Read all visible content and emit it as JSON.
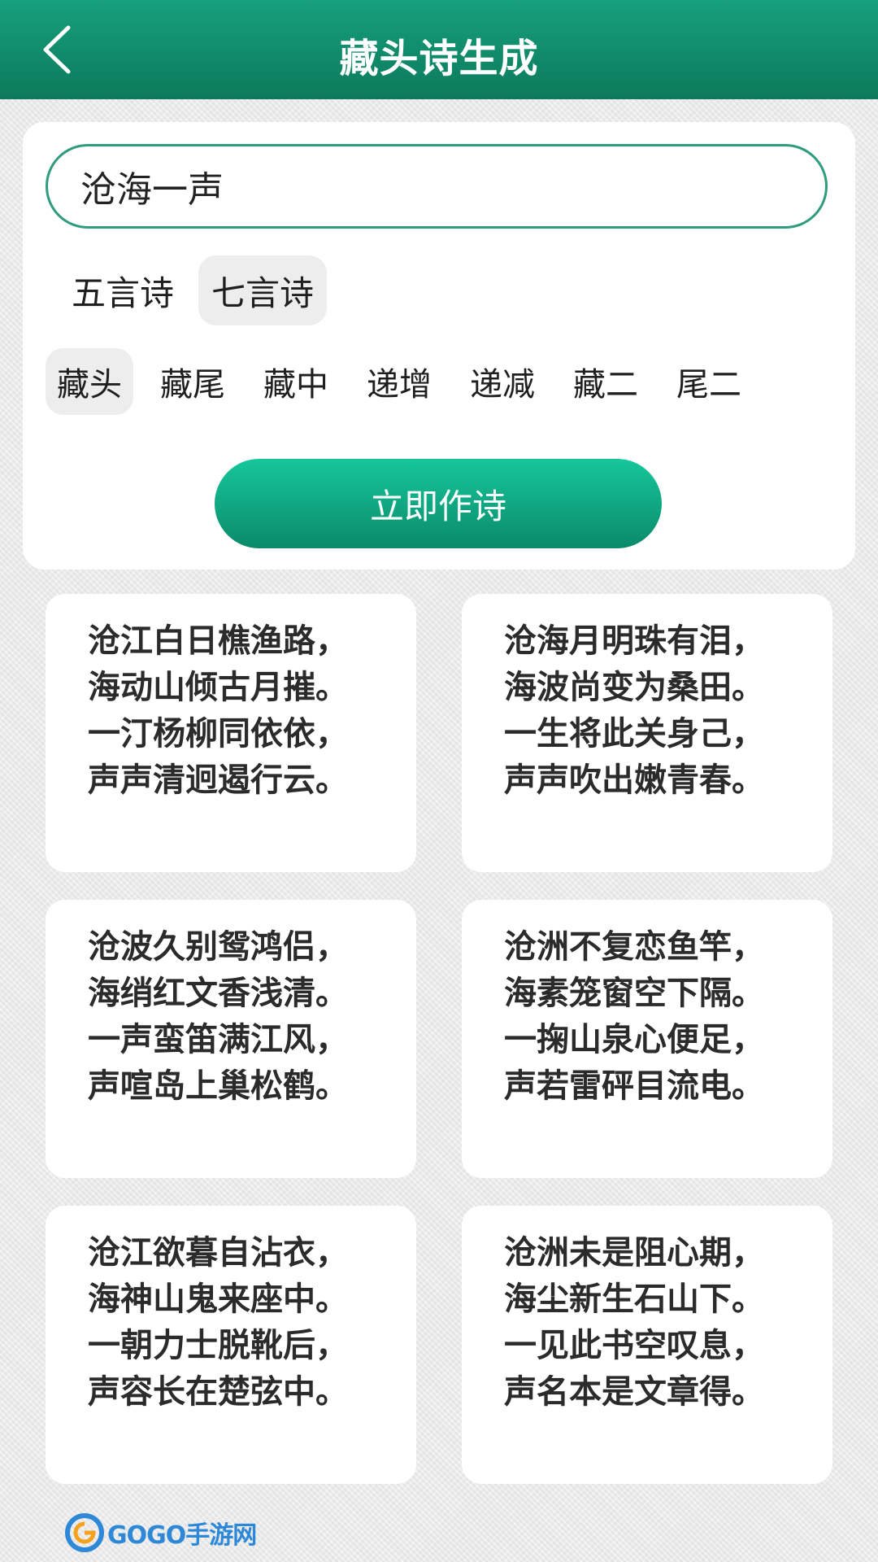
{
  "header": {
    "title": "藏头诗生成"
  },
  "search": {
    "value": "沧海一声"
  },
  "poem_types": [
    {
      "label": "五言诗",
      "selected": false
    },
    {
      "label": "七言诗",
      "selected": true
    }
  ],
  "modes": [
    {
      "label": "藏头",
      "selected": true
    },
    {
      "label": "藏尾",
      "selected": false
    },
    {
      "label": "藏中",
      "selected": false
    },
    {
      "label": "递增",
      "selected": false
    },
    {
      "label": "递减",
      "selected": false
    },
    {
      "label": "藏二",
      "selected": false
    },
    {
      "label": "尾二",
      "selected": false
    }
  ],
  "submit_label": "立即作诗",
  "poems": [
    {
      "lines": [
        "沧江白日樵渔路，",
        "海动山倾古月摧。",
        "一汀杨柳同依依，",
        "声声清迥遏行云。"
      ]
    },
    {
      "lines": [
        "沧海月明珠有泪，",
        "海波尚变为桑田。",
        "一生将此关身己，",
        "声声吹出嫩青春。"
      ]
    },
    {
      "lines": [
        "沧波久别鸳鸿侣，",
        "海绡红文香浅清。",
        "一声蛮笛满江风，",
        "声喧岛上巢松鹤。"
      ]
    },
    {
      "lines": [
        "沧洲不复恋鱼竿，",
        "海素笼窗空下隔。",
        "一掬山泉心便足，",
        "声若雷砰目流电。"
      ]
    },
    {
      "lines": [
        "沧江欲暮自沾衣，",
        "海神山鬼来座中。",
        "一朝力士脱靴后，",
        "声容长在楚弦中。"
      ]
    },
    {
      "lines": [
        "沧洲未是阻心期，",
        "海尘新生石山下。",
        "一见此书空叹息，",
        "声名本是文章得。"
      ]
    }
  ],
  "watermark": {
    "brand": "GOGO手游网"
  },
  "colors": {
    "header_top": "#17a07d",
    "header_bottom": "#0b7a5b",
    "accent": "#2f9c7d",
    "button_top": "#16c79b",
    "button_bottom": "#0a8a6a"
  }
}
